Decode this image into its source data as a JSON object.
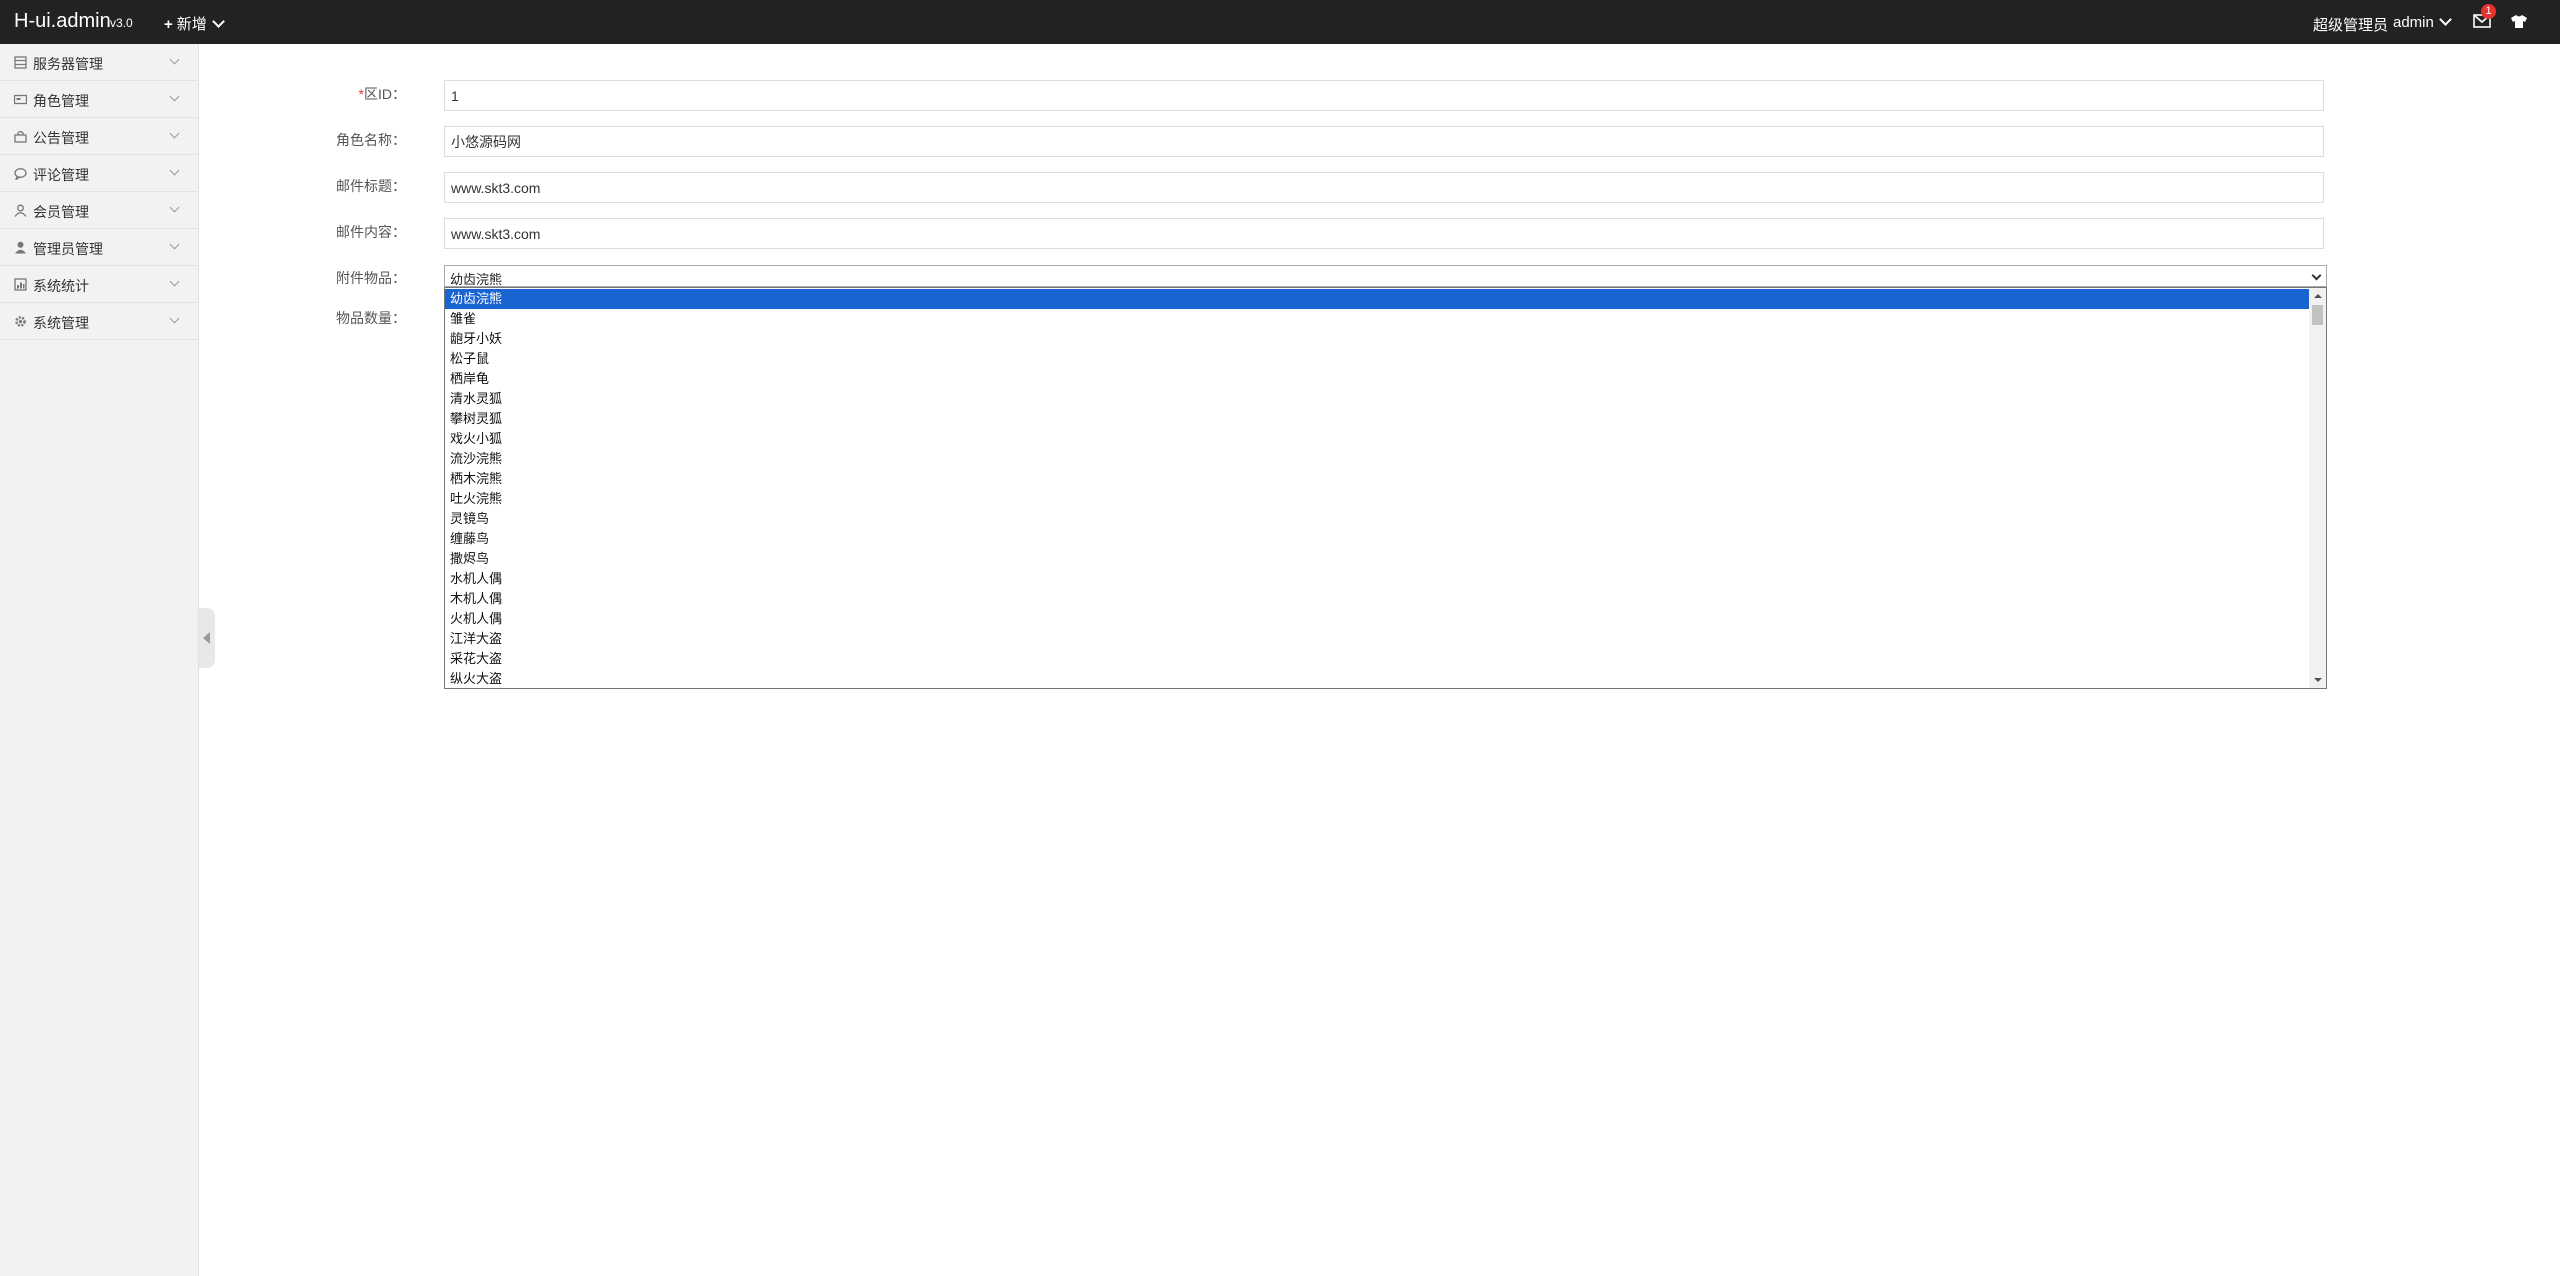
{
  "topbar": {
    "logo": "H-ui.admin",
    "version": "v3.0",
    "add_label": "新增",
    "role": "超级管理员",
    "user": "admin",
    "mail_badge": "1",
    "mail_icon": "envelope-icon",
    "skin_icon": "tshirt-icon",
    "bg_color": "#222222"
  },
  "sidebar": {
    "items": [
      {
        "label": "服务器管理",
        "icon": "server-icon"
      },
      {
        "label": "角色管理",
        "icon": "card-icon"
      },
      {
        "label": "公告管理",
        "icon": "bag-icon"
      },
      {
        "label": "评论管理",
        "icon": "comment-icon"
      },
      {
        "label": "会员管理",
        "icon": "user-outline-icon"
      },
      {
        "label": "管理员管理",
        "icon": "user-icon"
      },
      {
        "label": "系统统计",
        "icon": "chart-icon"
      },
      {
        "label": "系统管理",
        "icon": "gear-icon"
      }
    ]
  },
  "form": {
    "zone_id": {
      "label_req": "*",
      "label": "区ID：",
      "value": "1"
    },
    "role_name": {
      "label": "角色名称：",
      "value": "小悠源码网"
    },
    "mail_title": {
      "label": "邮件标题：",
      "value": "www.skt3.com"
    },
    "mail_content": {
      "label": "邮件内容：",
      "value": "www.skt3.com"
    },
    "attachment": {
      "label": "附件物品：",
      "selected": "幼齿浣熊",
      "options": [
        "幼齿浣熊",
        "雏雀",
        "龅牙小妖",
        "松子鼠",
        "栖岸龟",
        "清水灵狐",
        "攀树灵狐",
        "戏火小狐",
        "流沙浣熊",
        "栖木浣熊",
        "吐火浣熊",
        "灵镜鸟",
        "缠藤鸟",
        "撒烬鸟",
        "水机人偶",
        "木机人偶",
        "火机人偶",
        "江洋大盗",
        "采花大盗",
        "纵火大盗"
      ]
    },
    "quantity": {
      "label": "物品数量："
    }
  },
  "colors": {
    "selected_option": "#1a64d2",
    "required": "#e8322f",
    "badge": "#e8322f"
  }
}
